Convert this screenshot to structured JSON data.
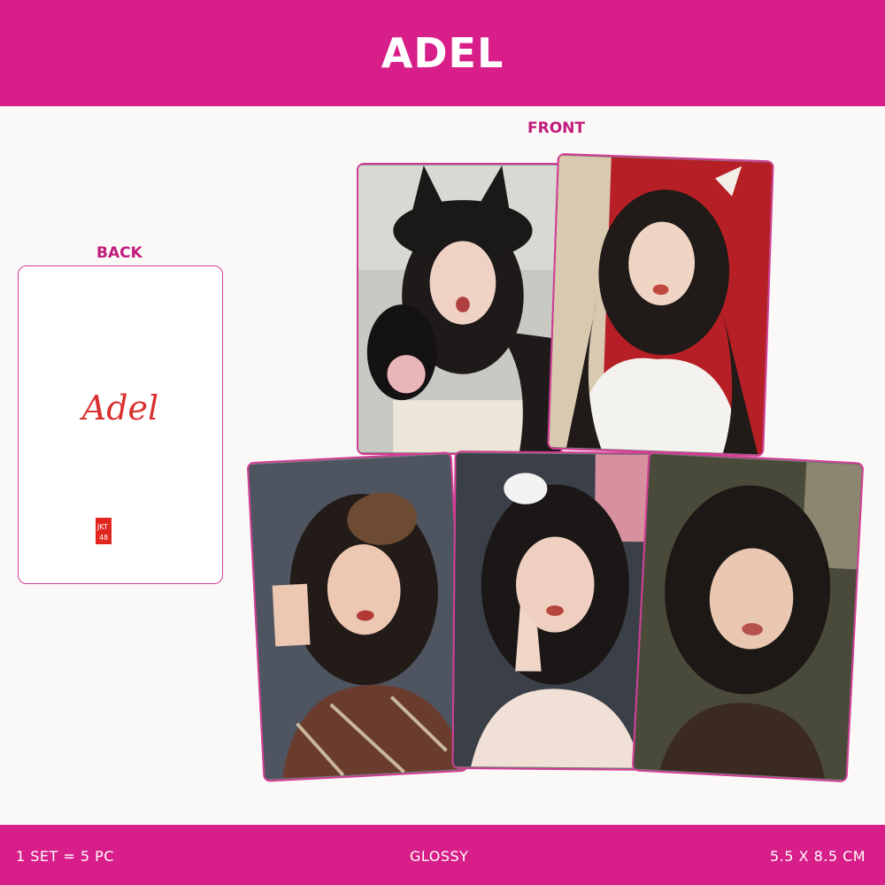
{
  "header": {
    "title": "ADEL"
  },
  "labels": {
    "front": "FRONT",
    "back": "BACK"
  },
  "back_card": {
    "signature": "Adel",
    "logo_text": "JKT48",
    "logo_icon": "jkt48-logo-icon"
  },
  "front_cards": [
    {
      "name": "photocard-1",
      "icon": "portrait-photo"
    },
    {
      "name": "photocard-2",
      "icon": "portrait-photo"
    },
    {
      "name": "photocard-3",
      "icon": "portrait-photo"
    },
    {
      "name": "photocard-4",
      "icon": "portrait-photo"
    },
    {
      "name": "photocard-5",
      "icon": "portrait-photo"
    }
  ],
  "footer": {
    "set_count": "1 SET = 5 PC",
    "finish": "GLOSSY",
    "size": "5.5 X 8.5 CM"
  },
  "colors": {
    "brand_pink": "#d81e88",
    "label_pink": "#c01b7c",
    "border_pink": "#d23d95",
    "signature_red": "#d8312f"
  }
}
